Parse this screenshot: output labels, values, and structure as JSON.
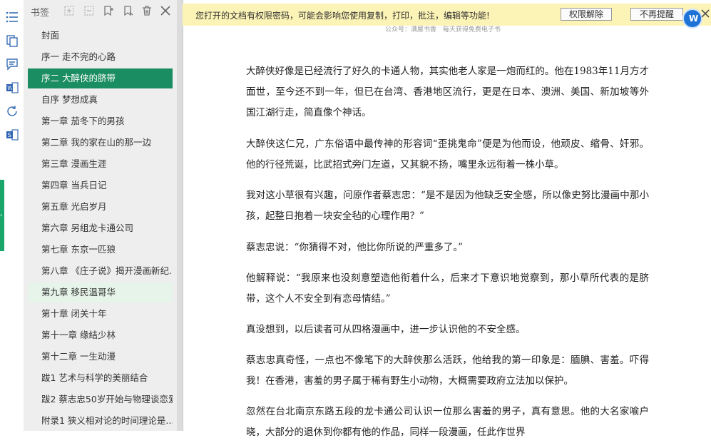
{
  "notice": {
    "text": "您打开的文档有权限密码，可能会影响您使用复制，打印，批注，编辑等功能!",
    "btn_unlock": "权限解除",
    "btn_dismiss": "不再提醒"
  },
  "sidebar": {
    "title": "书签",
    "items": [
      {
        "label": "封面"
      },
      {
        "label": "序一 走不完的心路"
      },
      {
        "label": "序二 大醉侠的脐带"
      },
      {
        "label": "自序 梦想成真"
      },
      {
        "label": "第一章 茄冬下的男孩"
      },
      {
        "label": "第二章 我的家在山的那一边"
      },
      {
        "label": "第三章 漫画生涯"
      },
      {
        "label": "第四章 当兵日记"
      },
      {
        "label": "第五章 光启岁月"
      },
      {
        "label": "第六章 另组龙卡通公司"
      },
      {
        "label": "第七章 东京一匹狼"
      },
      {
        "label": "第八章 《庄子说》揭开漫画新纪..."
      },
      {
        "label": "第九章 移民温哥华"
      },
      {
        "label": "第十章 闭关十年"
      },
      {
        "label": "第十一章 缘结少林"
      },
      {
        "label": "第十二章 一生动漫"
      },
      {
        "label": "跋1 艺术与科学的美丽结合"
      },
      {
        "label": "跋2 蔡志忠50岁开始与物理谈恋爱"
      },
      {
        "label": "附录1 狭义相对论的时间理论是..."
      }
    ],
    "active_index": 2,
    "hover_index": 12
  },
  "document": {
    "running_head": "公众号：满屋书香　每天获得免费电子书",
    "paragraphs": [
      "大醉侠好像是已经流行了好久的卡通人物，其实他老人家是一炮而红的。他在1983年11月方才面世，至今还不到一年，但已在台湾、香港地区流行，更是在日本、澳洲、美国、新加坡等外国江湖行走，简直像个神话。",
      "大醉侠这仁兄，广东俗语中最传神的形容词“歪挑鬼命”便是为他而设，他顽皮、缩骨、奸邪。他的行径荒诞，比武招式旁门左道，又其貌不扬，嘴里永远衔着一株小草。",
      "我对这小草很有兴趣，问原作者蔡志忠：“是不是因为他缺乏安全感，所以像史努比漫画中那小孩，起整日抱着一块安全毡的心理作用？”",
      "蔡志忠说：“你猜得不对，他比你所说的严重多了。”",
      "他解释说：“我原来也没刻意塑造他衔着什么，后来才下意识地觉察到，那小草所代表的是脐带，这个人不安全到有恋母情结。”",
      "真没想到，以后读者可从四格漫画中，进一步认识他的不安全感。",
      "蔡志忠真奇怪，一点也不像笔下的大醉侠那么活跃，他给我的第一印象是：腼腆、害羞。吓得我！在香港，害羞的男子属于稀有野生小动物，大概需要政府立法加以保护。",
      "忽然在台北南京东路五段的龙卡通公司认识一位那么害羞的男子，真有意思。他的大名家喻户晓，大部分的退休到你都有他的作品，同样一段漫画，任此作世界"
    ]
  },
  "colors": {
    "active_bg": "#1b8d63",
    "hover_bg": "#e6f4ea",
    "notice_bg": "#fcf4b6",
    "accent": "#1f72d6"
  }
}
